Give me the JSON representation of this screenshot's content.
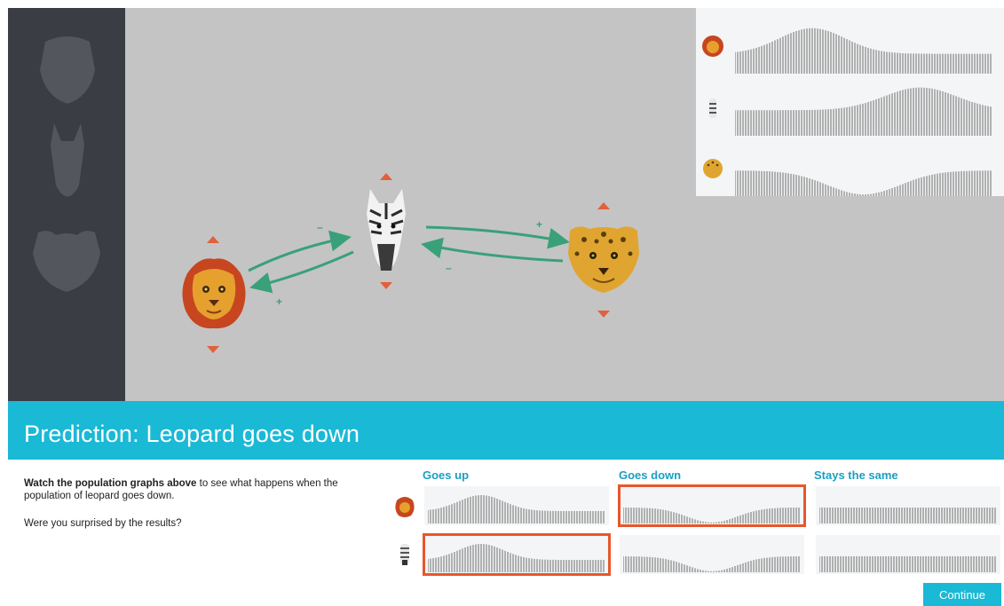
{
  "animals": [
    {
      "id": "lion",
      "name": "lion"
    },
    {
      "id": "zebra",
      "name": "zebra"
    },
    {
      "id": "leopard",
      "name": "leopard"
    }
  ],
  "food_web": {
    "signs": [
      "–",
      "+",
      "+",
      "–"
    ],
    "arrow_color": "#3aa07a",
    "arrow_control_color": "#e2603b"
  },
  "population_graphs": [
    {
      "animal": "lion-icon",
      "shape": "rise"
    },
    {
      "animal": "zebra-icon",
      "shape": "rise-late"
    },
    {
      "animal": "leopard-icon",
      "shape": "dip"
    }
  ],
  "banner": {
    "title": "Prediction: Leopard goes down"
  },
  "instructions": {
    "bold_text": "Watch the population graphs above",
    "text": " to see what happens when the population of leopard goes down.",
    "question": "Were you surprised by the results?"
  },
  "prediction": {
    "columns": [
      "Goes up",
      "Goes down",
      "Stays the same"
    ],
    "rows": [
      {
        "animal": "lion",
        "selected": "Goes down"
      },
      {
        "animal": "zebra",
        "selected": "Goes up"
      }
    ]
  },
  "colors": {
    "accent": "#1ab9d6",
    "selection": "#e8562b",
    "sidebar": "#3a3d44"
  },
  "continue_label": "Continue"
}
